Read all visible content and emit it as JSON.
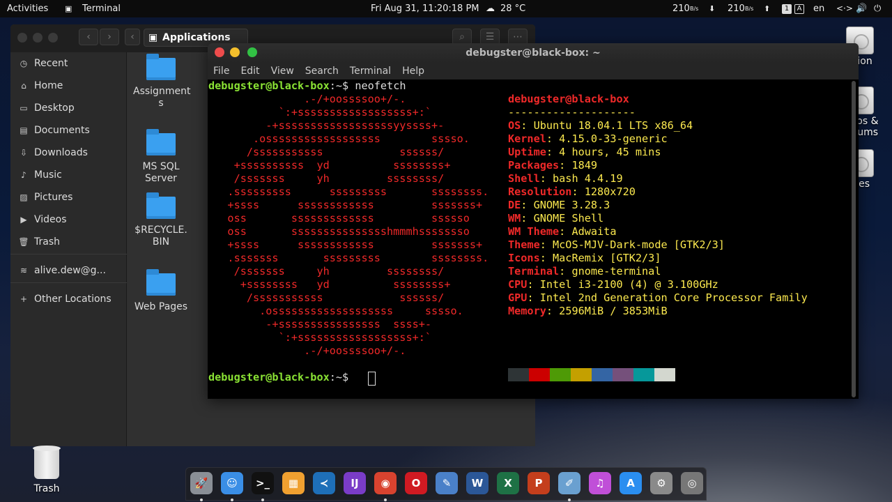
{
  "topbar": {
    "activities": "Activities",
    "app_name": "Terminal",
    "datetime": "Fri Aug 31, 11:20:18 PM",
    "weather": "28 °C",
    "net_down": "210",
    "net_down_unit": "B/s",
    "net_up": "210",
    "net_up_unit": "B/s",
    "kbd_a": "1",
    "kbd_b": "A",
    "lang": "en"
  },
  "desktop": {
    "icon_top": "ation",
    "icon_mid_a": "A lios &",
    "icon_mid_b": "Albums",
    "icon_bot": "vies"
  },
  "files": {
    "path": "Applications",
    "sidebar": [
      {
        "label": "Recent",
        "icon": "clock-icon"
      },
      {
        "label": "Home",
        "icon": "home-icon"
      },
      {
        "label": "Desktop",
        "icon": "desktop-icon"
      },
      {
        "label": "Documents",
        "icon": "documents-icon"
      },
      {
        "label": "Downloads",
        "icon": "downloads-icon"
      },
      {
        "label": "Music",
        "icon": "music-icon"
      },
      {
        "label": "Pictures",
        "icon": "pictures-icon"
      },
      {
        "label": "Videos",
        "icon": "videos-icon"
      },
      {
        "label": "Trash",
        "icon": "trash-icon"
      },
      {
        "label": "alive.dew@g...",
        "icon": "network-icon"
      },
      {
        "label": "Other Locations",
        "icon": "plus-icon"
      }
    ],
    "folders": [
      {
        "l1": "Assignment",
        "l2": "s"
      },
      {
        "l1": "MS SQL",
        "l2": "Server"
      },
      {
        "l1": "$RECYCLE.",
        "l2": "BIN"
      },
      {
        "l1": "Web Pages",
        "l2": ""
      }
    ]
  },
  "terminal": {
    "title": "debugster@black-box: ~",
    "menu": [
      "File",
      "Edit",
      "View",
      "Search",
      "Terminal",
      "Help"
    ],
    "prompt_user": "debugster@black-box",
    "prompt_path": ":~$",
    "command": "neofetch",
    "logo": [
      "               .-/+oossssoo+/-.",
      "           `:+ssssssssssssssssss+:`",
      "         -+ssssssssssssssssssyyssss+-",
      "       .ossssssssssssssssss        sssso.",
      "      /sssssssssss            ssssss/",
      "    +ssssssssss  yd          ssssssss+",
      "    /sssssss     yh         ssssssss/",
      "   .sssssssss      sssssssss       ssssssss.",
      "   +ssss      ssssssssssss         sssssss+",
      "   oss       sssssssssssss         ssssso",
      "   oss       ssssssssssssssshmmmhssssssso",
      "   +ssss      ssssssssssss         sssssss+",
      "   .sssssss       sssssssss        ssssssss.",
      "    /sssssss     yh         ssssssss/",
      "     +ssssssss   yd          ssssssss+",
      "      /sssssssssss            ssssss/",
      "        .osssssssssssssssssss     sssso.",
      "         -+ssssssssssssssss  ssss+-",
      "           `:+ssssssssssssssssss+:`",
      "               .-/+oossssoo+/-."
    ],
    "info_header": "debugster@black-box",
    "info_sep": "--------------------",
    "info": [
      {
        "k": "OS",
        "v": "Ubuntu 18.04.1 LTS x86_64"
      },
      {
        "k": "Kernel",
        "v": "4.15.0-33-generic"
      },
      {
        "k": "Uptime",
        "v": "4 hours, 45 mins"
      },
      {
        "k": "Packages",
        "v": "1849"
      },
      {
        "k": "Shell",
        "v": "bash 4.4.19"
      },
      {
        "k": "Resolution",
        "v": "1280x720"
      },
      {
        "k": "DE",
        "v": "GNOME 3.28.3"
      },
      {
        "k": "WM",
        "v": "GNOME Shell"
      },
      {
        "k": "WM Theme",
        "v": "Adwaita"
      },
      {
        "k": "Theme",
        "v": "McOS-MJV-Dark-mode [GTK2/3]"
      },
      {
        "k": "Icons",
        "v": "MacRemix [GTK2/3]"
      },
      {
        "k": "Terminal",
        "v": "gnome-terminal"
      },
      {
        "k": "CPU",
        "v": "Intel i3-2100 (4) @ 3.100GHz"
      },
      {
        "k": "GPU",
        "v": "Intel 2nd Generation Core Processor Family"
      },
      {
        "k": "Memory",
        "v": "2596MiB / 3853MiB"
      }
    ],
    "swatches": [
      "#2e3436",
      "#cc0000",
      "#4e9a06",
      "#c4a000",
      "#3465a4",
      "#75507b",
      "#06989a",
      "#d3d7cf"
    ]
  },
  "desktop_trash": "Trash",
  "dock": [
    {
      "name": "launchpad-icon",
      "glyph": "🚀",
      "bg": "#8a8f96",
      "dot": true
    },
    {
      "name": "finder-icon",
      "glyph": "☺",
      "bg": "#3a8ee6",
      "dot": true
    },
    {
      "name": "terminal-app-icon",
      "glyph": ">_",
      "bg": "#111111",
      "dot": true
    },
    {
      "name": "mosaic-app-icon",
      "glyph": "▦",
      "bg": "#f0a030",
      "dot": false
    },
    {
      "name": "vscode-icon",
      "glyph": "≺",
      "bg": "#1e6fb8",
      "dot": false
    },
    {
      "name": "intellij-icon",
      "glyph": "IJ",
      "bg": "#7a3cc8",
      "dot": false
    },
    {
      "name": "chrome-icon",
      "glyph": "◉",
      "bg": "#d9432f",
      "dot": true
    },
    {
      "name": "opera-icon",
      "glyph": "O",
      "bg": "#d01a22",
      "dot": false
    },
    {
      "name": "file-manager-icon",
      "glyph": "✎",
      "bg": "#4a80c8",
      "dot": false
    },
    {
      "name": "word-icon",
      "glyph": "W",
      "bg": "#2b5797",
      "dot": false
    },
    {
      "name": "excel-icon",
      "glyph": "X",
      "bg": "#1e7145",
      "dot": false
    },
    {
      "name": "powerpoint-icon",
      "glyph": "P",
      "bg": "#c43e1c",
      "dot": false
    },
    {
      "name": "editor-icon",
      "glyph": "✐",
      "bg": "#6aa0d0",
      "dot": true
    },
    {
      "name": "itunes-icon",
      "glyph": "♫",
      "bg": "#c04fd8",
      "dot": false
    },
    {
      "name": "app-store-icon",
      "glyph": "A",
      "bg": "#2a8ef0",
      "dot": false
    },
    {
      "name": "settings-app-icon",
      "glyph": "⚙",
      "bg": "#8a8a8a",
      "dot": false
    },
    {
      "name": "system-prefs-icon",
      "glyph": "◎",
      "bg": "#777777",
      "dot": false
    }
  ]
}
